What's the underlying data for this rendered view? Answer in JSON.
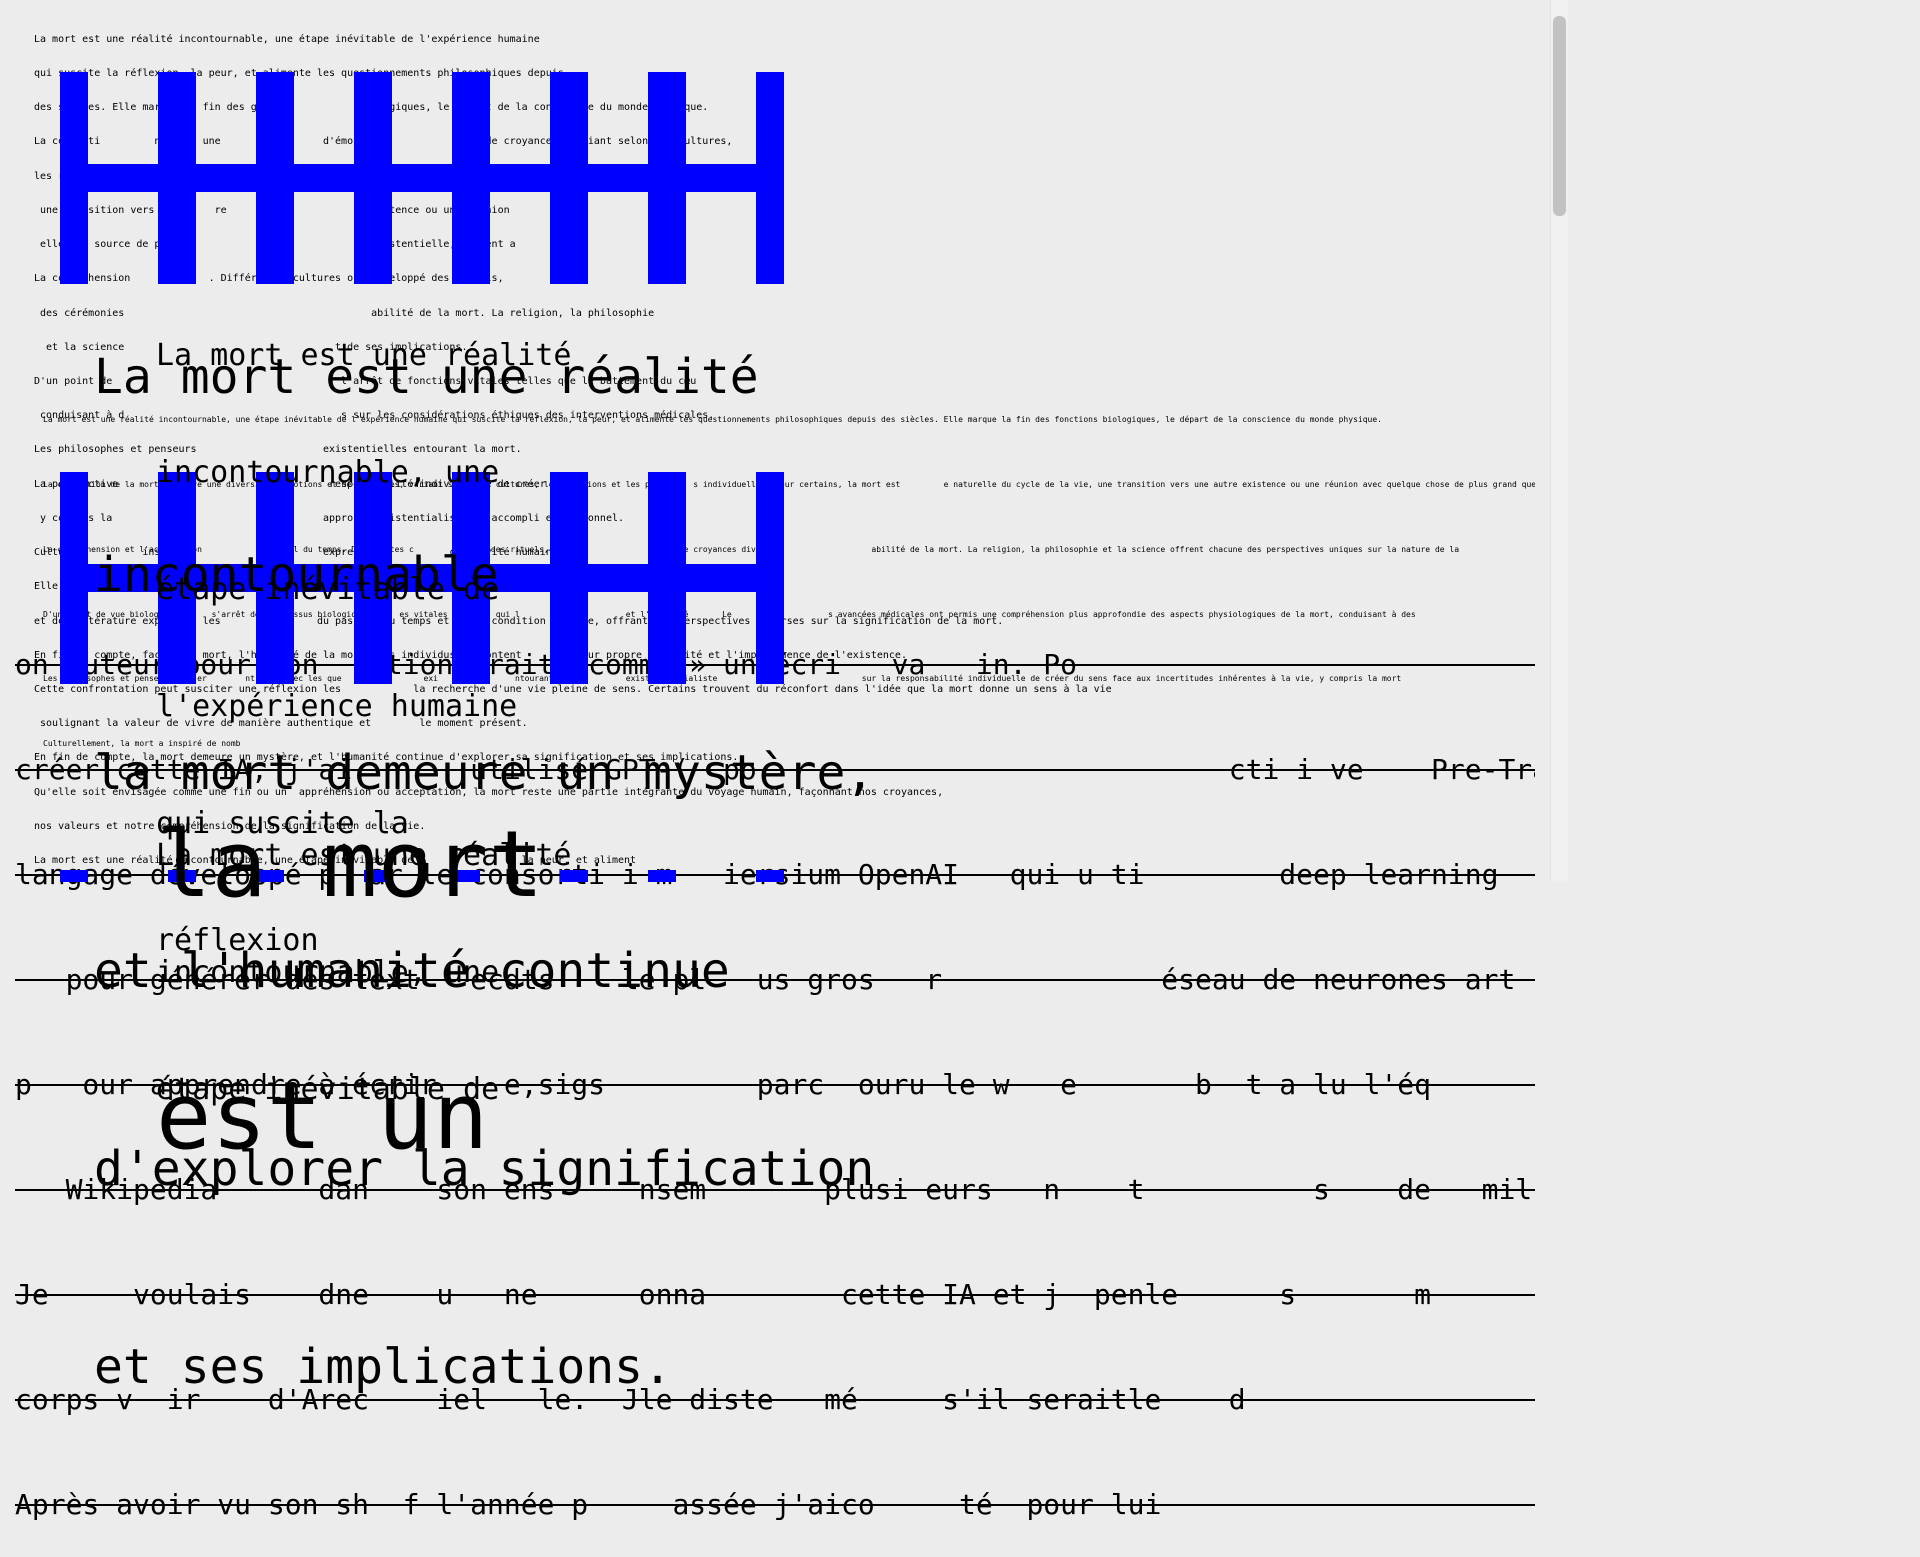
{
  "top_block": [
    "La mort est une réalité incontournable, une étape inévitable de l'expérience humaine",
    "qui suscite la réflexion, la peur, et alimente les questionnements philosophiques depuis",
    "des siècles. Elle marque la fin des gxxw              biologiques, le départ de la conscience du monde physique.",
    "La concepti         ngendre une                 d'émotions              et de croyances, variant selon les cultures,",
    "les religions           spe s, la mort est une partie naturelle du cycle de la vie",
    " une transition vers une      re                       existence ou une réunion",
    " elle est source de peur                                existentielle, souvent a",
    "La compréhension             . Différentes cultures ont développé des rituels,",
    " des cérémonies                                         abilité de la mort. La religion, la philosophie",
    "  et la science                                   t de ses implications.",
    "D'un point de                                      l'arrêt de fonctions vitales telles que le battement du cœu",
    " conduisant à d                                    s sur les considérations éthiques des interventions médicales.",
    "Les philosophes et penseurs                     existentielles entourant la mort.",
    "La perspective                                   responsabilité individuelle de créer",
    " y compris la                                   approche existentialiste    accompli et personnel.",
    "Cultu             insp                          expressio            créativité humaine.",
    "Elle a inspiré de mot        ant, symbolisant à la fois la fragilité et le fil      nombreuses œuvres d'art",
    "et de littérature explorent les                du passage du temps et de la condition humaine, offrant des perspectives diverses sur la signification de la mort.",
    "En fin de compte, face à la mort, l'humanité de la mort, les individus affrontent         leur propre mortalité et l'impermanence de l'existence.",
    "Cette confrontation peut susciter une réflexion les            la recherche d'une vie pleine de sens. Certains trouvent du réconfort dans l'idée que la mort donne un sens à la vie",
    " soulignant la valeur de vivre de manière authentique et        le moment présent.",
    "En fin de compte, la mort demeure un mystère, et l'humanité continue d'explorer sa signification et ses implications.",
    "Qu'elle soit envisagée comme une fin ou un  appréhension ou acceptation, la mort reste une partie intégrante du voyage humain, façonnant nos croyances,",
    "nos valeurs et notre compréhension de la signification de la vie.",
    "La mort est une réalité incontournable, une étape inévitable de                , la peur, et aliment"
  ],
  "mid_block": [
    "La mort est une réalité incontournable, une étape inévitable de l'expérience humaine qui suscite la réflexion, la peur, et alimente les questionnements philosophiques depuis des siècles. Elle marque la fin des fonctions biologiques, le départ de la conscience du monde physique.",
    "La conception de la mort engendre une diversité d'émotions et de croyances, variant selon les cultures, les religions et les pe        s individuelles. Pour certains, la mort est         e naturelle du cycle de la vie, une transition vers une autre existence ou une réunion avec quelque chose de plus grand que nous-mê",
    "La compréhension et l'acceptation            t au fil du temps. Différentes c        veloppé des rituels, d                     mes de croyances diver                      abilité de la mort. La religion, la philosophie et la science offrent chacune des perspectives uniques sur la nature de la",
    "D'un point de vue biologique       s'arrêt des processus biologiques      es vitales          qui l             a        et l'activité       Le                    s avancées médicales ont permis une compréhension plus approfondie des aspects physiologiques de la mort, conduisant à des",
    "Les philosophes et penseurs     er        nt      avec les que    ns           exi    stenti      ntourant la            existe    ntialiste          em                  sur la responsabilité individuelle de créer du sens face aux incertitudes inhérentes à la vie, y compris la mort",
    "Culturellement, la mort a inspiré de nomb"
  ],
  "big_para": [
    "La mort est une réalité",
    "incontournable",
    "la mort demeure un mystère,",
    "et l'humanité continue",
    "d'explorer la signification",
    "et ses implications."
  ],
  "mid_para": [
    "La mort est une réalité",
    "incontournable, une",
    "étape inévitable de",
    "l'expérience humaine",
    "qui suscite la",
    "réflexion"
  ],
  "strike_lines": [
    "on auteur pour son   ntionnerait  comme » un écri   va   in. Po",
    "créer cette IA, j'ai       utilisé GPT-(  po                            cti i ve    Pre-Training",
    "langage développé p  ar le consorti i m   iersium OpenAI   qui u ti        deep learning",
    "   pour générer des text   ecdts    le pl   us gros   r             éseau de neurones art",
    "p   our apprendre à écrir    e,sigs         parc  ouru le w   e       b  t a lu l'éq",
    "   Wikipedia      dan    son ens     nsem       plusi eurs   n    t          s    de   mil",
    "Je     voulais    dne    u   ne      onna        cette IA et j  penle      s       m",
    "corps v  ir    d'Arec    iel   le.  Jle diste   mé     s'il seraitle    d",
    "Après avoir vu son sh  f l'année p     assée j'aico     té  pour lui"
  ],
  "huge_text": [
    "la mort",
    "est un"
  ],
  "lower_para": [
    "La mort est une réalité",
    "incontournable, une",
    "étape inévitable de"
  ],
  "glyph_letter": "H",
  "accent_color": "#0000ff"
}
